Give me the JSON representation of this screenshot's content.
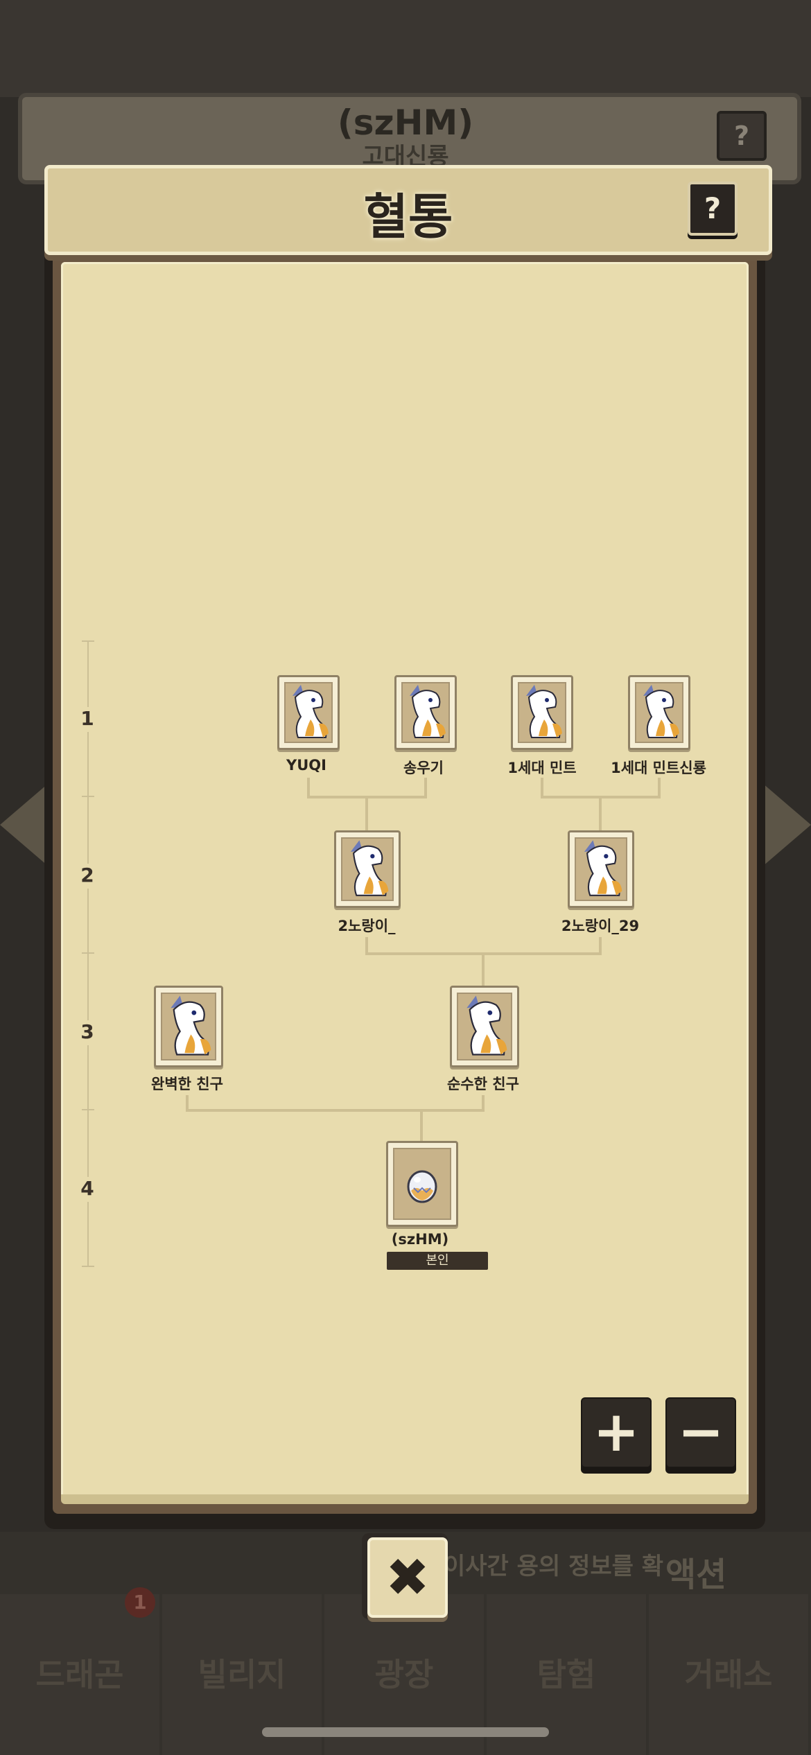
{
  "background": {
    "card_name": "(szHM)",
    "card_subtitle": "고대신룡",
    "help_label": "?",
    "banner_text": "이사간 용의 정보를 확",
    "action_text": "액션",
    "nav": [
      {
        "label": "드래곤"
      },
      {
        "label": "빌리지"
      },
      {
        "label": "광장"
      },
      {
        "label": "탐험"
      },
      {
        "label": "거래소"
      }
    ],
    "nav_badge": "1"
  },
  "modal": {
    "title": "혈통",
    "help_label": "?",
    "generations": [
      "1",
      "2",
      "3",
      "4"
    ],
    "tree": {
      "gen1": [
        {
          "name": "YUQI"
        },
        {
          "name": "송우기"
        },
        {
          "name": "1세대 민트"
        },
        {
          "name": "1세대 민트신룡"
        }
      ],
      "gen2": [
        {
          "name": "2노랑이_"
        },
        {
          "name": "2노랑이_29"
        }
      ],
      "gen3": [
        {
          "name": "완벽한 친구"
        },
        {
          "name": "순수한 친구"
        }
      ],
      "self": {
        "name": "(szHM)",
        "badge": "본인"
      }
    },
    "zoom_in_label": "+",
    "zoom_out_label": "−",
    "close_label": "✖"
  },
  "colors": {
    "paper": "#e8dcae",
    "frame": "#231f1b",
    "ink": "#2a241d",
    "dragon_accent": "#e8a53a"
  }
}
